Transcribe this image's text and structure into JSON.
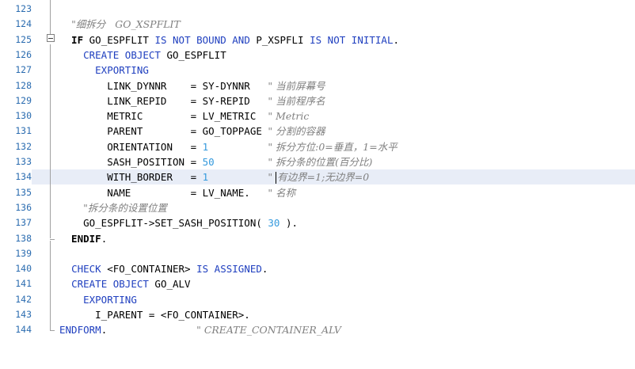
{
  "editor": {
    "current_line": 134,
    "lines": [
      {
        "no": "123",
        "tokens": []
      },
      {
        "no": "124",
        "tokens": [
          {
            "t": "  ",
            "c": "id"
          },
          {
            "t": "\"细拆分   GO_XSPFLIT",
            "c": "cm"
          }
        ]
      },
      {
        "no": "125",
        "tokens": [
          {
            "t": "  IF ",
            "c": "kwb"
          },
          {
            "t": "GO_ESPFLIT ",
            "c": "id"
          },
          {
            "t": "IS NOT BOUND AND ",
            "c": "kw"
          },
          {
            "t": "P_XSPFLI ",
            "c": "id"
          },
          {
            "t": "IS NOT INITIAL",
            "c": "kw"
          },
          {
            "t": ".",
            "c": "op"
          }
        ]
      },
      {
        "no": "126",
        "tokens": [
          {
            "t": "    ",
            "c": "id"
          },
          {
            "t": "CREATE OBJECT ",
            "c": "kw"
          },
          {
            "t": "GO_ESPFLIT",
            "c": "id"
          }
        ]
      },
      {
        "no": "127",
        "tokens": [
          {
            "t": "      ",
            "c": "id"
          },
          {
            "t": "EXPORTING",
            "c": "kw"
          }
        ]
      },
      {
        "no": "128",
        "tokens": [
          {
            "t": "        LINK_DYNNR    = SY-DYNNR   ",
            "c": "id"
          },
          {
            "t": "\" 当前屏幕号",
            "c": "cm"
          }
        ]
      },
      {
        "no": "129",
        "tokens": [
          {
            "t": "        LINK_REPID    = SY-REPID   ",
            "c": "id"
          },
          {
            "t": "\" 当前程序名",
            "c": "cm"
          }
        ]
      },
      {
        "no": "130",
        "tokens": [
          {
            "t": "        METRIC        = LV_METRIC  ",
            "c": "id"
          },
          {
            "t": "\" Metric",
            "c": "cm"
          }
        ]
      },
      {
        "no": "131",
        "tokens": [
          {
            "t": "        PARENT        = GO_TOPPAGE ",
            "c": "id"
          },
          {
            "t": "\" 分割的容器",
            "c": "cm"
          }
        ]
      },
      {
        "no": "132",
        "tokens": [
          {
            "t": "        ORIENTATION   = ",
            "c": "id"
          },
          {
            "t": "1",
            "c": "num"
          },
          {
            "t": "          ",
            "c": "id"
          },
          {
            "t": "\" 拆分方位:0=垂直，1=水平",
            "c": "cm"
          }
        ]
      },
      {
        "no": "133",
        "tokens": [
          {
            "t": "        SASH_POSITION = ",
            "c": "id"
          },
          {
            "t": "50",
            "c": "num"
          },
          {
            "t": "         ",
            "c": "id"
          },
          {
            "t": "\" 拆分条的位置(百分比)",
            "c": "cm"
          }
        ]
      },
      {
        "no": "134",
        "tokens": [
          {
            "t": "        WITH_BORDER   = ",
            "c": "id"
          },
          {
            "t": "1",
            "c": "num"
          },
          {
            "t": "          ",
            "c": "id"
          },
          {
            "t": "\" ",
            "c": "cm"
          },
          {
            "t": "",
            "c": "caret"
          },
          {
            "t": "有边界=1;无边界=0",
            "c": "cm"
          }
        ]
      },
      {
        "no": "135",
        "tokens": [
          {
            "t": "        NAME          = LV_NAME.   ",
            "c": "id"
          },
          {
            "t": "\" 名称",
            "c": "cm"
          }
        ]
      },
      {
        "no": "136",
        "tokens": [
          {
            "t": "    ",
            "c": "id"
          },
          {
            "t": "\"拆分条的设置位置",
            "c": "cm"
          }
        ]
      },
      {
        "no": "137",
        "tokens": [
          {
            "t": "    GO_ESPFLIT->SET_SASH_POSITION( ",
            "c": "id"
          },
          {
            "t": "30",
            "c": "num"
          },
          {
            "t": " ).",
            "c": "id"
          }
        ]
      },
      {
        "no": "138",
        "tokens": [
          {
            "t": "  ENDIF",
            "c": "kwb"
          },
          {
            "t": ".",
            "c": "op"
          }
        ]
      },
      {
        "no": "139",
        "tokens": []
      },
      {
        "no": "140",
        "tokens": [
          {
            "t": "  ",
            "c": "id"
          },
          {
            "t": "CHECK ",
            "c": "kw"
          },
          {
            "t": "<FO_CONTAINER> ",
            "c": "id"
          },
          {
            "t": "IS ASSIGNED",
            "c": "kw"
          },
          {
            "t": ".",
            "c": "op"
          }
        ]
      },
      {
        "no": "141",
        "tokens": [
          {
            "t": "  ",
            "c": "id"
          },
          {
            "t": "CREATE OBJECT ",
            "c": "kw"
          },
          {
            "t": "GO_ALV",
            "c": "id"
          }
        ]
      },
      {
        "no": "142",
        "tokens": [
          {
            "t": "    ",
            "c": "id"
          },
          {
            "t": "EXPORTING",
            "c": "kw"
          }
        ]
      },
      {
        "no": "143",
        "tokens": [
          {
            "t": "      I_PARENT = <FO_CONTAINER>.",
            "c": "id"
          }
        ]
      },
      {
        "no": "144",
        "tokens": [
          {
            "t": "ENDFORM",
            "c": "kw"
          },
          {
            "t": ".",
            "c": "op"
          },
          {
            "t": "               ",
            "c": "id"
          },
          {
            "t": "\" CREATE_CONTAINER_ALV",
            "c": "cm"
          }
        ]
      }
    ]
  }
}
